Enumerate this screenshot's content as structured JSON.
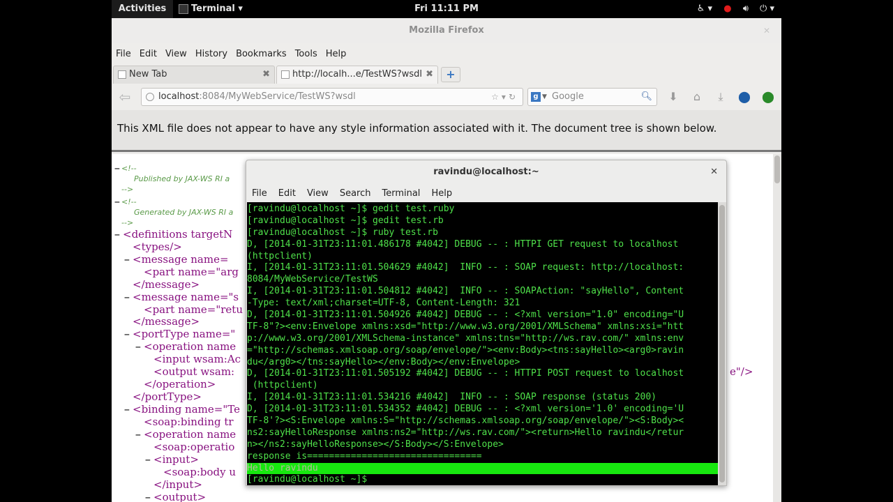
{
  "topbar": {
    "activities": "Activities",
    "app": "Terminal",
    "app_arrow": "▾",
    "clock": "Fri 11:11 PM",
    "icons": [
      "accessibility-icon",
      "record-icon",
      "volume-icon",
      "power-icon"
    ]
  },
  "firefox": {
    "title": "Mozilla Firefox",
    "menu": [
      "File",
      "Edit",
      "View",
      "History",
      "Bookmarks",
      "Tools",
      "Help"
    ],
    "tabs": [
      {
        "label": "New Tab"
      },
      {
        "label": "http://localh...e/TestWS?wsdl"
      }
    ],
    "url_host": "localhost",
    "url_rest": ":8084/MyWebService/TestWS?wsdl",
    "search_placeholder": "Google",
    "info_message": "This XML file does not appear to have any style information associated with it. The document tree is shown below."
  },
  "xml": {
    "comment1_open": "<!--",
    "comment1_text": "Published by JAX-WS RI a",
    "comment_close": "-->",
    "comment2_open": "<!--",
    "comment2_text": "Generated by JAX-WS RI a",
    "lines": [
      "<definitions targetN",
      "<types/>",
      "<message name=",
      "<part name=\"arg",
      "</message>",
      "<message name=\"s",
      "<part name=\"retu",
      "</message>",
      "<portType name=\"",
      "<operation name",
      "<input wsam:Ac",
      "<output wsam:",
      "</operation>",
      "</portType>",
      "<binding name=\"Te",
      "<soap:binding tr",
      "<operation name",
      "<soap:operatio",
      "<input>",
      "<soap:body u",
      "</input>",
      "<output>"
    ],
    "fragment_right": "e\"/>"
  },
  "terminal": {
    "title": "ravindu@localhost:~",
    "menu": [
      "File",
      "Edit",
      "View",
      "Search",
      "Terminal",
      "Help"
    ],
    "lines": [
      "[ravindu@localhost ~]$ gedit test.ruby",
      "[ravindu@localhost ~]$ gedit test.rb",
      "[ravindu@localhost ~]$ ruby test.rb",
      "D, [2014-01-31T23:11:01.486178 #4042] DEBUG -- : HTTPI GET request to localhost",
      "(httpclient)",
      "I, [2014-01-31T23:11:01.504629 #4042]  INFO -- : SOAP request: http://localhost:",
      "8084/MyWebService/TestWS",
      "I, [2014-01-31T23:11:01.504812 #4042]  INFO -- : SOAPAction: \"sayHello\", Content",
      "-Type: text/xml;charset=UTF-8, Content-Length: 321",
      "D, [2014-01-31T23:11:01.504926 #4042] DEBUG -- : <?xml version=\"1.0\" encoding=\"U",
      "TF-8\"?><env:Envelope xmlns:xsd=\"http://www.w3.org/2001/XMLSchema\" xmlns:xsi=\"htt",
      "p://www.w3.org/2001/XMLSchema-instance\" xmlns:tns=\"http://ws.rav.com/\" xmlns:env",
      "=\"http://schemas.xmlsoap.org/soap/envelope/\"><env:Body><tns:sayHello><arg0>ravin",
      "du</arg0></tns:sayHello></env:Body></env:Envelope>",
      "D, [2014-01-31T23:11:01.505192 #4042] DEBUG -- : HTTPI POST request to localhost",
      " (httpclient)",
      "I, [2014-01-31T23:11:01.534216 #4042]  INFO -- : SOAP response (status 200)",
      "D, [2014-01-31T23:11:01.534352 #4042] DEBUG -- : <?xml version='1.0' encoding='U",
      "TF-8'?><S:Envelope xmlns:S=\"http://schemas.xmlsoap.org/soap/envelope/\"><S:Body><",
      "ns2:sayHelloResponse xmlns:ns2=\"http://ws.rav.com/\"><return>Hello ravindu</retur",
      "n></ns2:sayHelloResponse></S:Body></S:Envelope>",
      "response is================================",
      "Hello ravindu",
      "[ravindu@localhost ~]$ "
    ],
    "highlight_index": 22
  },
  "colors": {
    "terminal_text": "#4fe14a",
    "terminal_highlight": "#17e80f",
    "xml_tag": "#881280",
    "xml_comment": "#5a9a48"
  }
}
